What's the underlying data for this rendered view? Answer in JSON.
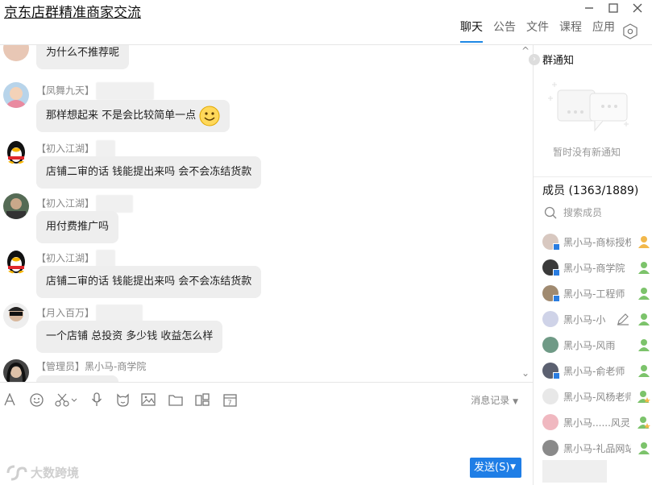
{
  "window": {
    "title": "京东店群精准商家交流"
  },
  "tabs": [
    "聊天",
    "公告",
    "文件",
    "课程",
    "应用"
  ],
  "messages": [
    {
      "sender_tag": "",
      "sender_name": "",
      "text": "为什么不推荐呢"
    },
    {
      "sender_tag": "【凤舞九天】",
      "sender_name": "",
      "text": "那样想起来 不是会比较简单一点"
    },
    {
      "sender_tag": "【初入江湖】",
      "sender_name": "",
      "text": "店铺二审的话  钱能提出来吗  会不会冻结货款"
    },
    {
      "sender_tag": "【初入江湖】",
      "sender_name": "",
      "text": "用付费推广吗"
    },
    {
      "sender_tag": "【初入江湖】",
      "sender_name": "",
      "text": "店铺二审的话  钱能提出来吗  会不会冻结货款"
    },
    {
      "sender_tag": "【月入百万】",
      "sender_name": "",
      "text": "一个店铺 总投资  多少钱  收益怎么样"
    },
    {
      "sender_tag": "【管理员】",
      "sender_name": "黑小马-商学院",
      "text": ""
    }
  ],
  "notice": {
    "title": "群通知",
    "empty_text": "暂时没有新通知"
  },
  "members": {
    "title": "成员 (1363/1889)",
    "search_placeholder": "搜索成员",
    "list": [
      {
        "name": "黑小马-商标授权"
      },
      {
        "name": "黑小马-商学院"
      },
      {
        "name": "黑小马-工程师"
      },
      {
        "name": "黑小马-小"
      },
      {
        "name": "黑小马-风雨"
      },
      {
        "name": "黑小马-俞老师"
      },
      {
        "name": "黑小马-风杨老师"
      },
      {
        "name": "黑小马......风灵"
      },
      {
        "name": "黑小马-礼品网站"
      }
    ]
  },
  "toolbar": {
    "icons": [
      "font-icon",
      "emoji-icon",
      "scissors-icon",
      "mic-icon",
      "sticker-icon",
      "image-icon",
      "folder-icon",
      "apps-icon",
      "calendar-icon"
    ],
    "history_label": "消息记录"
  },
  "send_label": "发送(S)",
  "watermark": "大数跨境",
  "colors": {
    "accent": "#1f7ee6",
    "bubble": "#eeeeee"
  }
}
